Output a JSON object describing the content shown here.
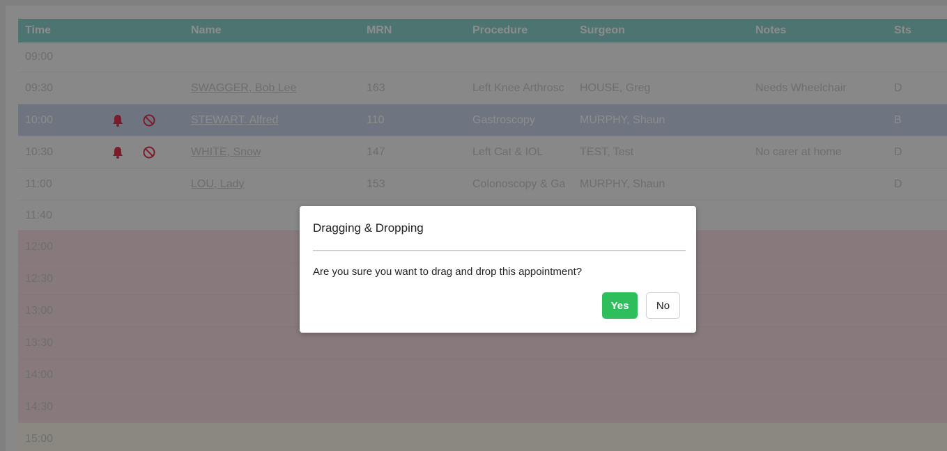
{
  "columns": [
    "Time",
    "",
    "Name",
    "MRN",
    "Procedure",
    "Surgeon",
    "Notes",
    "Sts"
  ],
  "rows": [
    {
      "time": "09:00",
      "name": "",
      "mrn": "",
      "procedure": "",
      "surgeon": "",
      "notes": "",
      "status": ""
    },
    {
      "time": "09:30",
      "name": "SWAGGER, Bob Lee",
      "mrn": "163",
      "procedure": "Left Knee Arthrosc",
      "surgeon": "HOUSE, Greg",
      "notes": "Needs Wheelchair",
      "status": "D"
    },
    {
      "time": "10:00",
      "name": "STEWART, Alfred",
      "mrn": "110",
      "procedure": "Gastroscopy",
      "surgeon": "MURPHY, Shaun",
      "notes": "",
      "status": "B"
    },
    {
      "time": "10:30",
      "name": "WHITE, Snow",
      "mrn": "147",
      "procedure": "Left Cat & IOL",
      "surgeon": "TEST, Test",
      "notes": "No carer at home",
      "status": "D"
    },
    {
      "time": "11:00",
      "name": "LOU, Lady",
      "mrn": "153",
      "procedure": "Colonoscopy & Ga",
      "surgeon": "MURPHY, Shaun",
      "notes": "",
      "status": "D"
    },
    {
      "time": "11:40",
      "name": "",
      "mrn": "",
      "procedure": "",
      "surgeon": "",
      "notes": "",
      "status": ""
    },
    {
      "time": "12:00",
      "name": "",
      "mrn": "",
      "procedure": "",
      "surgeon": "",
      "notes": "",
      "status": ""
    },
    {
      "time": "12:30",
      "name": "",
      "mrn": "",
      "procedure": "",
      "surgeon": "",
      "notes": "",
      "status": ""
    },
    {
      "time": "13:00",
      "name": "",
      "mrn": "",
      "procedure": "",
      "surgeon": "",
      "notes": "",
      "status": ""
    },
    {
      "time": "13:30",
      "name": "",
      "mrn": "",
      "procedure": "",
      "surgeon": "",
      "notes": "",
      "status": ""
    },
    {
      "time": "14:00",
      "name": "",
      "mrn": "",
      "procedure": "",
      "surgeon": "",
      "notes": "",
      "status": ""
    },
    {
      "time": "14:30",
      "name": "",
      "mrn": "",
      "procedure": "",
      "surgeon": "",
      "notes": "",
      "status": ""
    },
    {
      "time": "15:00",
      "name": "",
      "mrn": "",
      "procedure": "",
      "surgeon": "",
      "notes": "",
      "status": ""
    }
  ],
  "icons": {
    "alert": "bell-icon",
    "cancel": "no-entry-icon"
  },
  "modal": {
    "title": "Dragging & Dropping",
    "message": "Are you sure you want to drag and drop this appointment?",
    "yes_label": "Yes",
    "no_label": "No"
  },
  "colors": {
    "header": "#8dd3cc",
    "selected_row": "#c9d6e9",
    "lunch_zone": "#f7dfe2",
    "alert_icon": "#e0344f",
    "yes_button": "#2ebf5c"
  }
}
